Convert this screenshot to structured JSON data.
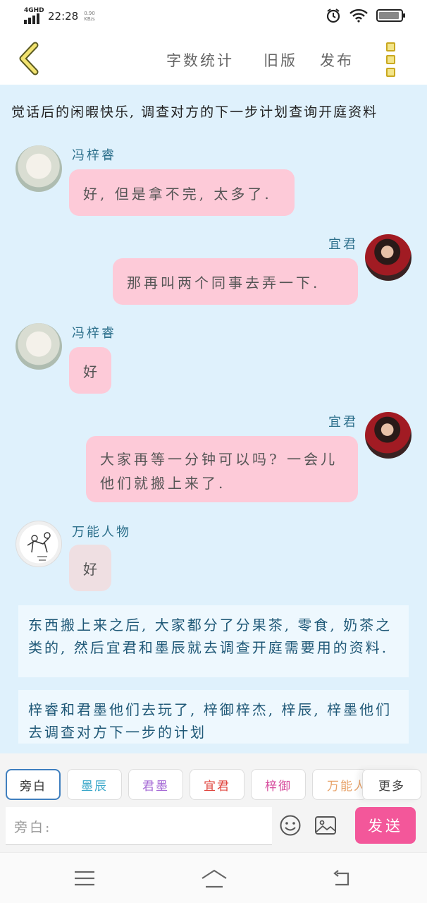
{
  "status_bar": {
    "network": "4GHD",
    "time": "22:28",
    "speed": "0.90 KB/s"
  },
  "header": {
    "word_count": "字数统计",
    "old_version": "旧版",
    "publish": "发布"
  },
  "chat": {
    "topic": "觉话后的闲暇快乐, 调查对方的下一步计划查询开庭资料",
    "messages": [
      {
        "side": "left",
        "name": "冯梓睿",
        "text": "好, 但是拿不完, 太多了.",
        "avatar": "avatar-feng"
      },
      {
        "side": "right",
        "name": "宜君",
        "text": "那再叫两个同事去弄一下.",
        "avatar": "avatar-yijun"
      },
      {
        "side": "left",
        "name": "冯梓睿",
        "text": "好",
        "avatar": "avatar-feng"
      },
      {
        "side": "right",
        "name": "宜君",
        "text": "大家再等一分钟可以吗? 一会儿他们就搬上来了.",
        "avatar": "avatar-yijun"
      },
      {
        "side": "left",
        "name": "万能人物",
        "text": "好",
        "avatar": "avatar-wanneng"
      }
    ],
    "narrations": [
      "东西搬上来之后, 大家都分了分果茶, 零食, 奶茶之类的, 然后宜君和墨辰就去调查开庭需要用的资料.",
      "梓睿和君墨他们去玩了, 梓御梓杰, 梓辰, 梓墨他们去调查对方下一步的计划"
    ]
  },
  "roles": {
    "chips": [
      {
        "label": "旁白",
        "color": "#444444"
      },
      {
        "label": "墨辰",
        "color": "#3aa7c9"
      },
      {
        "label": "君墨",
        "color": "#a66bd6"
      },
      {
        "label": "宜君",
        "color": "#e0463f"
      },
      {
        "label": "梓御",
        "color": "#d64a9c"
      },
      {
        "label": "万能人物",
        "color": "#e8a36a"
      }
    ],
    "more": "更多"
  },
  "composer": {
    "placeholder": "旁白:",
    "send": "发送"
  },
  "icons": [
    "back-icon",
    "menu-icon",
    "emoji-icon",
    "image-icon",
    "nav-menu-icon",
    "nav-home-icon",
    "nav-back-icon",
    "alarm-icon",
    "wifi-icon",
    "battery-icon"
  ]
}
